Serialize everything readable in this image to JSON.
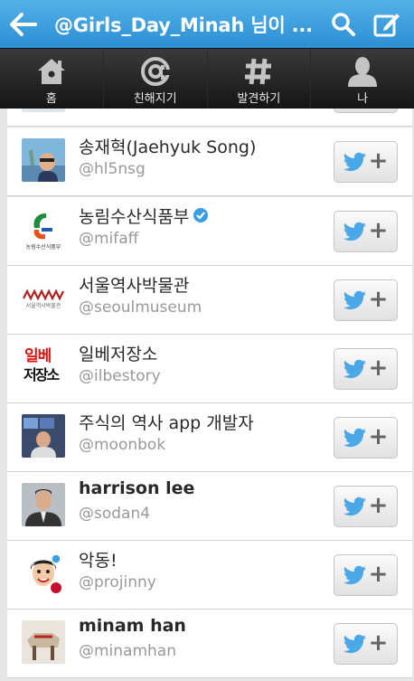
{
  "header": {
    "title": "@Girls_Day_Minah 님이 ...",
    "back_icon": "back-arrow-icon",
    "search_icon": "search-icon",
    "compose_icon": "compose-icon",
    "bg_color": "#3a9fe0"
  },
  "tabs": [
    {
      "label": "홈",
      "icon": "home-icon"
    },
    {
      "label": "친해지기",
      "icon": "at-icon"
    },
    {
      "label": "발견하기",
      "icon": "hashtag-icon"
    },
    {
      "label": "나",
      "icon": "person-icon"
    }
  ],
  "users": [
    {
      "name": "송재혁(Jaehyuk Song)",
      "handle": "@hl5nsg",
      "bold": false,
      "verified": false
    },
    {
      "name": "농림수산식품부",
      "handle": "@mifaff",
      "bold": false,
      "verified": true,
      "avatar_caption": "농림수산식품부"
    },
    {
      "name": "서울역사박물관",
      "handle": "@seoulmuseum",
      "bold": false,
      "verified": false,
      "avatar_caption": "서울역사박물관"
    },
    {
      "name": "일베저장소",
      "handle": "@ilbestory",
      "bold": false,
      "verified": false,
      "avatar_text_top": "일베",
      "avatar_text_bottom": "저장소"
    },
    {
      "name": "주식의 역사 app 개발자",
      "handle": "@moonbok",
      "bold": false,
      "verified": false
    },
    {
      "name": "harrison lee",
      "handle": "@sodan4",
      "bold": true,
      "verified": false
    },
    {
      "name": "악동!",
      "handle": "@projinny",
      "bold": false,
      "verified": false
    },
    {
      "name": "minam han",
      "handle": "@minamhan",
      "bold": true,
      "verified": false
    }
  ],
  "follow_button": {
    "icon": "twitter-bird-icon",
    "plus": "+"
  },
  "colors": {
    "accent": "#3a9fe0",
    "bird": "#4aa8e8",
    "tabbar": "#222222"
  }
}
